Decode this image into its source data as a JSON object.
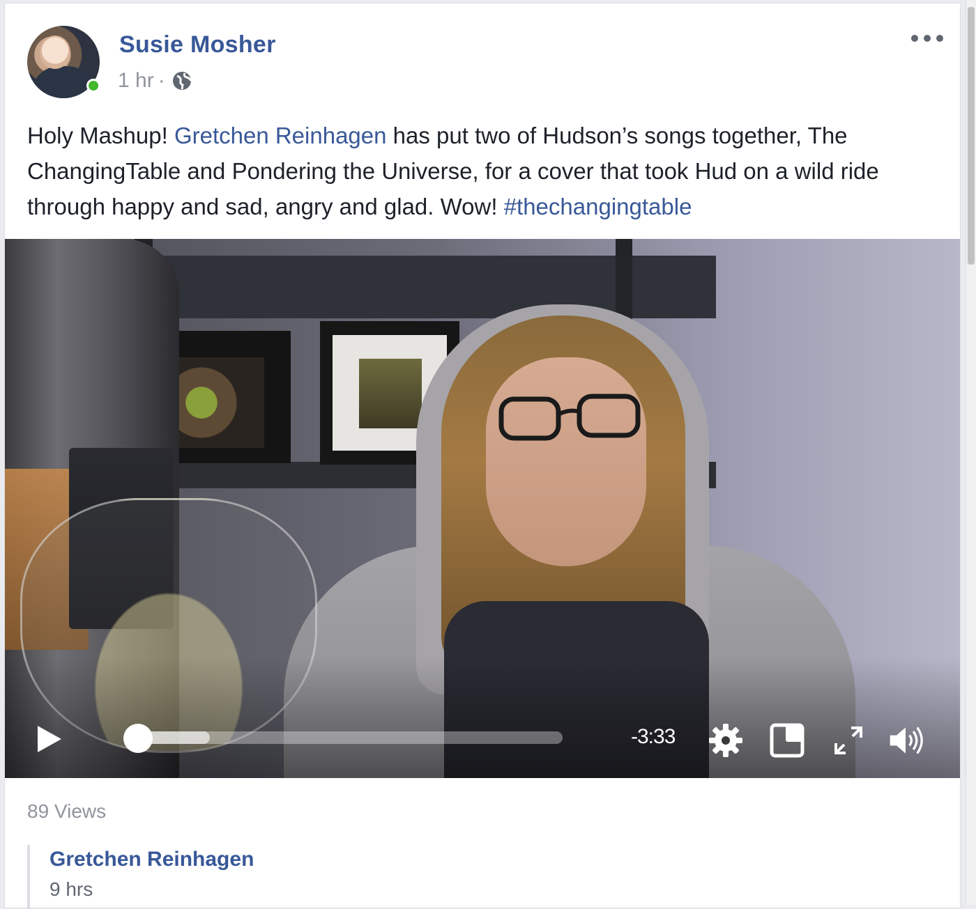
{
  "post": {
    "author": "Susie Mosher",
    "timestamp": "1 hr",
    "separator": "·",
    "privacy_icon": "globe-icon",
    "more_icon": "more-options-icon",
    "text_before_link": "Holy Mashup! ",
    "tagged_person": "Gretchen Reinhagen",
    "text_after_link": " has put two of Hudson’s songs together, The ChangingTable and Pondering the Universe, for a cover that took Hud on a wild ride through happy and sad, angry and glad. Wow! ",
    "hashtag": "#thechangingtable"
  },
  "video": {
    "play_icon": "play-icon",
    "progress": 0.15,
    "time_remaining": "-3:33",
    "settings_icon": "gear-icon",
    "pip_icon": "picture-in-picture-icon",
    "fullscreen_icon": "fullscreen-icon",
    "volume_icon": "volume-icon"
  },
  "stats": {
    "views": "89 Views"
  },
  "share_preview": {
    "name": "Gretchen Reinhagen",
    "time": "9 hrs"
  },
  "colors": {
    "link": "#385898",
    "online": "#42b72a",
    "meta": "#90949c"
  }
}
